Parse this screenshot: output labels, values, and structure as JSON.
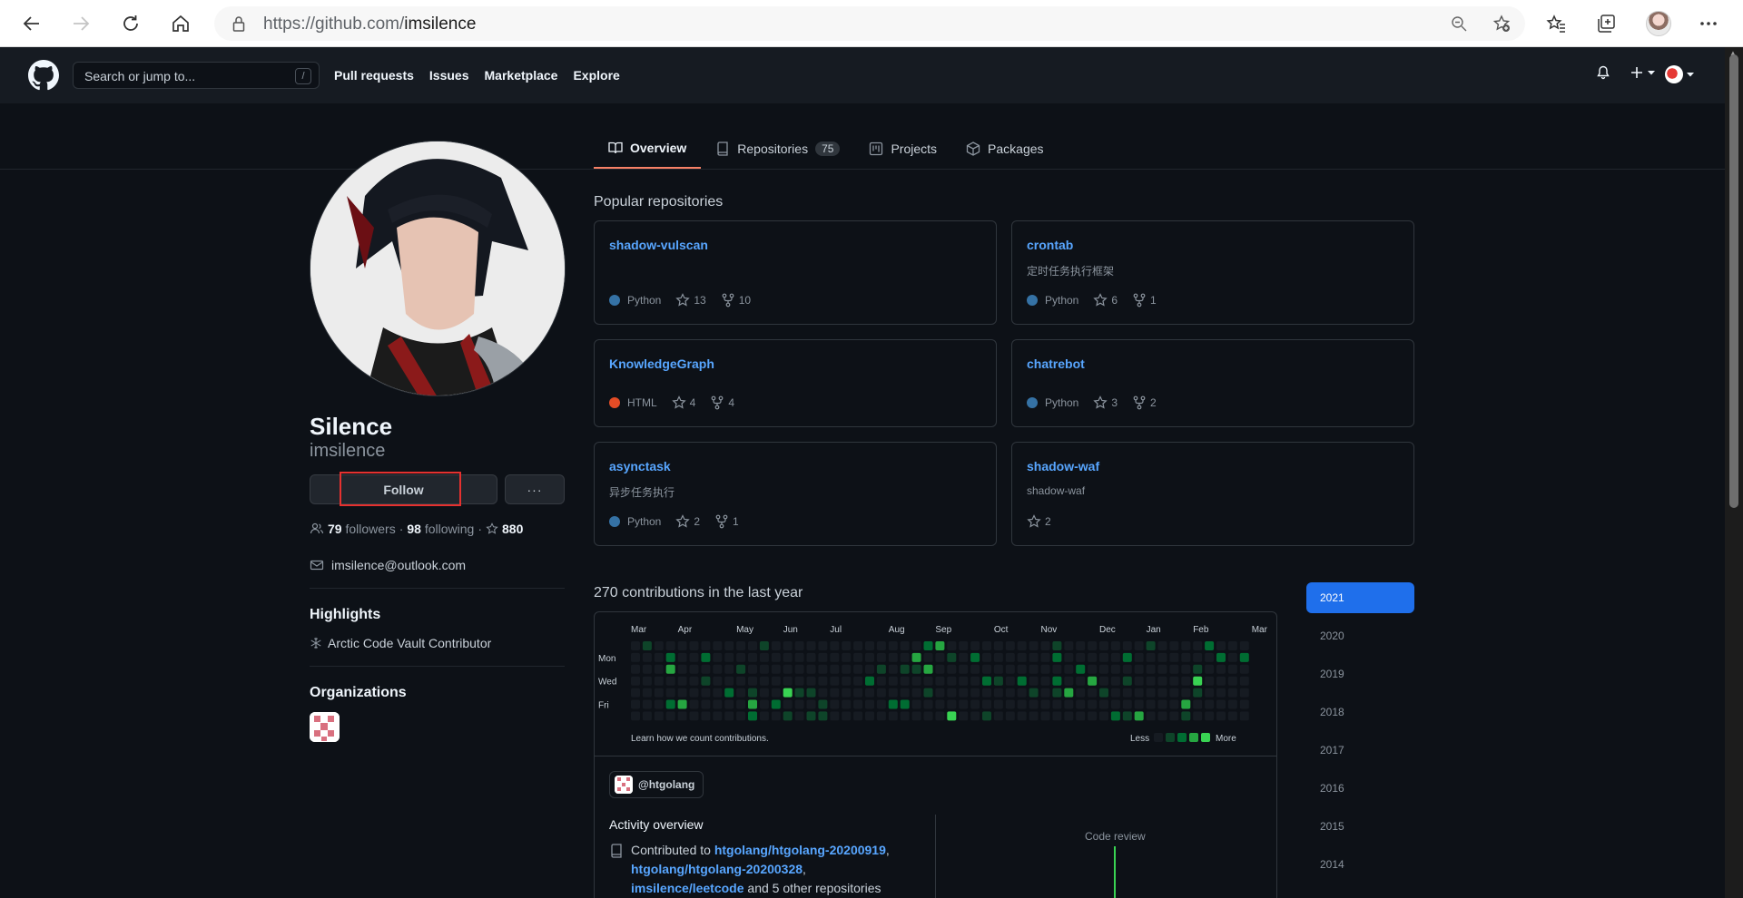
{
  "browser": {
    "url_prefix": "https://github.com/",
    "url_path": "imsilence"
  },
  "header": {
    "search_placeholder": "Search or jump to...",
    "search_shortcut": "/",
    "nav": [
      "Pull requests",
      "Issues",
      "Marketplace",
      "Explore"
    ]
  },
  "tabs": [
    {
      "label": "Overview",
      "icon": "book-icon"
    },
    {
      "label": "Repositories",
      "icon": "repo-icon",
      "count": "75"
    },
    {
      "label": "Projects",
      "icon": "project-icon"
    },
    {
      "label": "Packages",
      "icon": "package-icon"
    }
  ],
  "profile": {
    "name": "Silence",
    "login": "imsilence",
    "follow_label": "Follow",
    "more_label": "···",
    "followers": "79",
    "followers_label": "followers",
    "following": "98",
    "following_label": "following",
    "stars": "880",
    "email": "imsilence@outlook.com",
    "highlights_title": "Highlights",
    "highlight": "Arctic Code Vault Contributor",
    "orgs_title": "Organizations"
  },
  "popular": {
    "title": "Popular repositories",
    "repos": [
      {
        "name": "shadow-vulscan",
        "desc": "",
        "lang": "Python",
        "lang_color": "#3572A5",
        "stars": "13",
        "forks": "10"
      },
      {
        "name": "crontab",
        "desc": "定时任务执行框架",
        "lang": "Python",
        "lang_color": "#3572A5",
        "stars": "6",
        "forks": "1"
      },
      {
        "name": "KnowledgeGraph",
        "desc": "",
        "lang": "HTML",
        "lang_color": "#e34c26",
        "stars": "4",
        "forks": "4"
      },
      {
        "name": "chatrebot",
        "desc": "",
        "lang": "Python",
        "lang_color": "#3572A5",
        "stars": "3",
        "forks": "2"
      },
      {
        "name": "asynctask",
        "desc": "异步任务执行",
        "lang": "Python",
        "lang_color": "#3572A5",
        "stars": "2",
        "forks": "1"
      },
      {
        "name": "shadow-waf",
        "desc": "shadow-waf",
        "lang": "",
        "lang_color": "",
        "stars": "2",
        "forks": ""
      }
    ]
  },
  "contributions": {
    "title": "270 contributions in the last year",
    "months": [
      "Mar",
      "Apr",
      "May",
      "Jun",
      "Jul",
      "Aug",
      "Sep",
      "Oct",
      "Nov",
      "Dec",
      "Jan",
      "Feb",
      "Mar"
    ],
    "days": [
      "Mon",
      "Wed",
      "Fri"
    ],
    "learn": "Learn how we count contributions.",
    "less": "Less",
    "more": "More"
  },
  "activity": {
    "org": "@htgolang",
    "title": "Activity overview",
    "contributed": "Contributed to",
    "repo1": "htgolang/htgolang-20200919",
    "repo2": "htgolang/htgolang-20200328",
    "repo3": "imsilence/leetcode",
    "tail": "and 5 other repositories",
    "code_review": "Code review"
  },
  "years": [
    "2021",
    "2020",
    "2019",
    "2018",
    "2017",
    "2016",
    "2015",
    "2014"
  ]
}
